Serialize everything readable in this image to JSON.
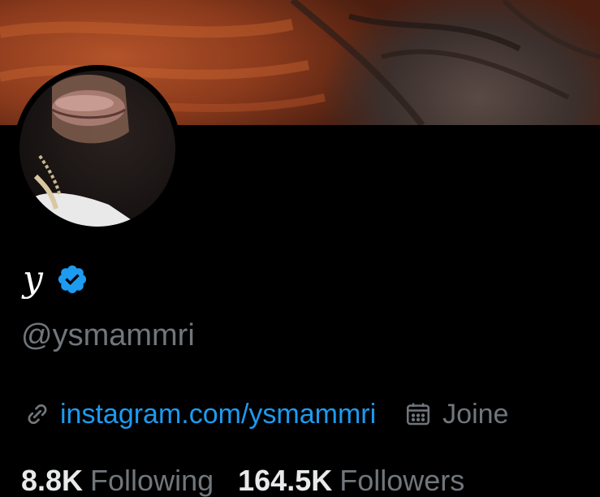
{
  "profile": {
    "display_name": "y",
    "handle": "@ysmammri",
    "verified": true,
    "website": "instagram.com/ysmammri",
    "joined": "Joine",
    "stats": {
      "following_count": "8.8K",
      "following_label": "Following",
      "followers_count": "164.5K",
      "followers_label": "Followers"
    }
  },
  "colors": {
    "background": "#000000",
    "link": "#1d9bf0",
    "verified_badge": "#1d9bf0",
    "secondary_text": "#71767b",
    "primary_text": "#e7e9ea"
  },
  "icons": {
    "verified": "verified-badge-icon",
    "website": "link-icon",
    "joined": "calendar-icon"
  }
}
